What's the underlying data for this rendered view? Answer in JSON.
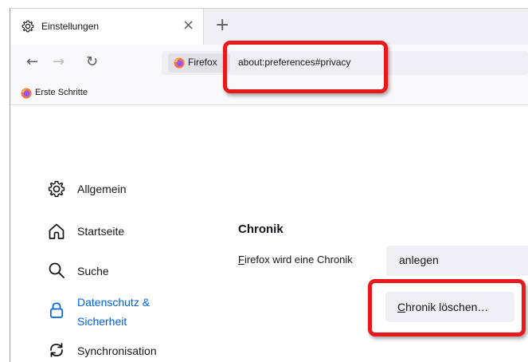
{
  "tab": {
    "title": "Einstellungen",
    "close_glyph": "×",
    "new_tab_glyph": "+"
  },
  "nav": {
    "back_glyph": "←",
    "forward_glyph": "→",
    "reload_glyph": "↻",
    "identity_label": "Firefox",
    "url": "about:preferences#privacy"
  },
  "bookmarks": {
    "items": [
      {
        "label": "Erste Schritte"
      }
    ]
  },
  "sidebar": {
    "items": [
      {
        "label": "Allgemein",
        "icon": "gear-icon"
      },
      {
        "label": "Startseite",
        "icon": "home-icon"
      },
      {
        "label": "Suche",
        "icon": "search-icon"
      },
      {
        "label_line1": "Datenschutz &",
        "label_line2": "Sicherheit",
        "icon": "lock-icon",
        "active": true
      },
      {
        "label": "Synchronisation",
        "icon": "sync-icon"
      }
    ]
  },
  "history": {
    "title": "Chronik",
    "label_access": "F",
    "label_rest": "irefox wird eine Chronik",
    "select_value": "anlegen",
    "clear_button_access": "C",
    "clear_button_rest": "hronik löschen…"
  },
  "colors": {
    "accent": "#0061e0",
    "highlight": "#e8181b",
    "firefox_orange": "#ff7139",
    "firefox_purple": "#9059ff"
  }
}
